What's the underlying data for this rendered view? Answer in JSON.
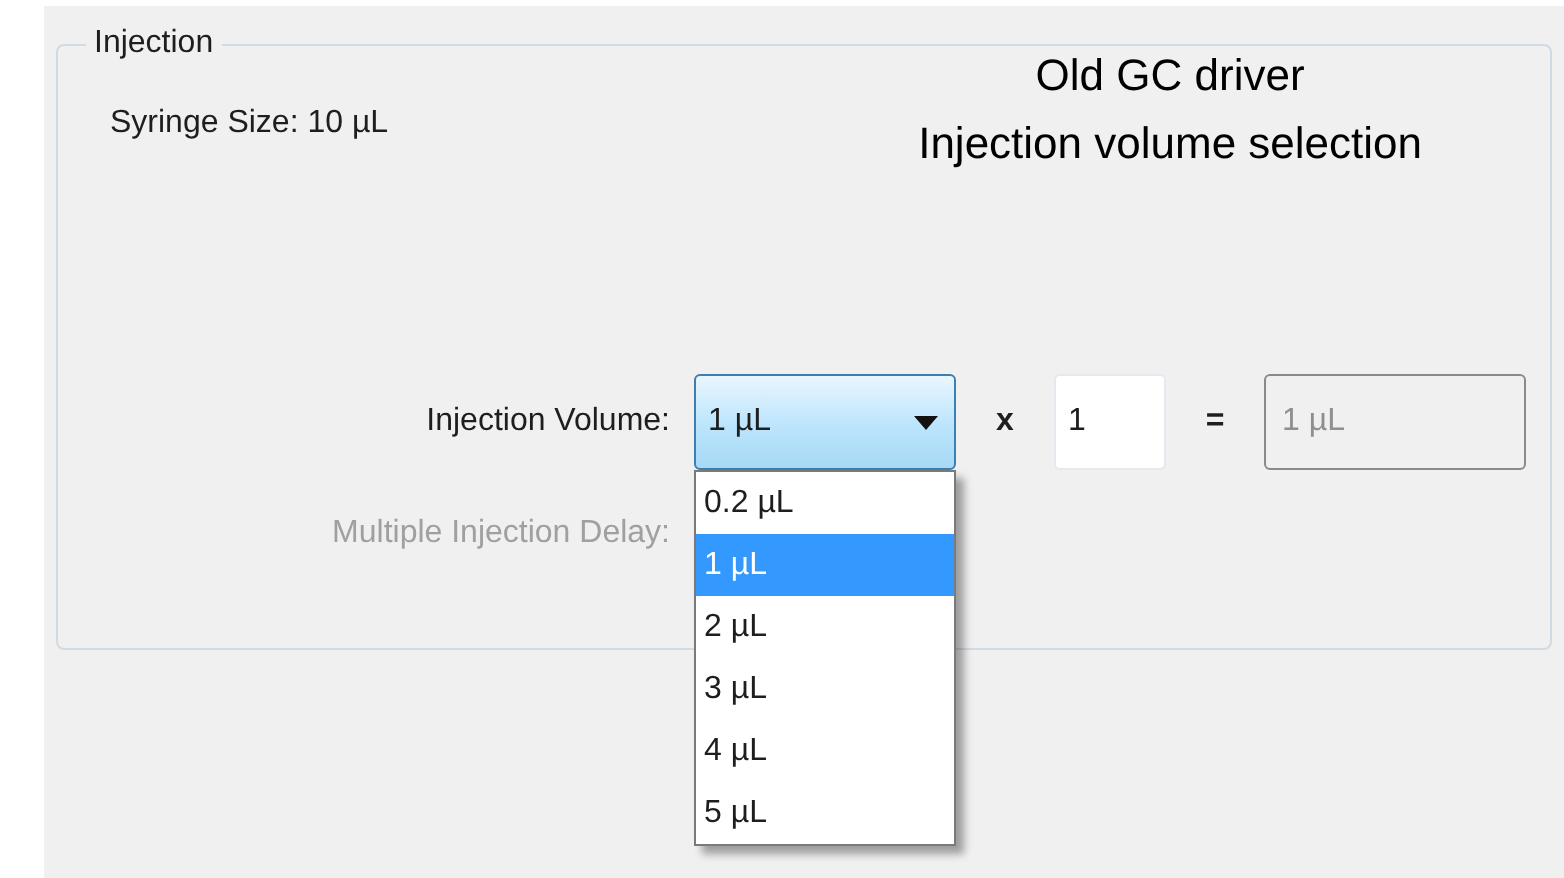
{
  "group": {
    "title": "Injection"
  },
  "syringe_size": "Syringe Size: 10 µL",
  "annotation": [
    "Old GC driver",
    "Injection volume selection"
  ],
  "injection_volume": {
    "label": "Injection Volume:",
    "value": "1 µL",
    "expanded": true,
    "options": [
      {
        "label": "0.2 µL",
        "selected": false
      },
      {
        "label": "1 µL",
        "selected": true
      },
      {
        "label": "2 µL",
        "selected": false
      },
      {
        "label": "3 µL",
        "selected": false
      },
      {
        "label": "4 µL",
        "selected": false
      },
      {
        "label": "5 µL",
        "selected": false
      }
    ]
  },
  "multiplier": {
    "symbol": "x",
    "value": "1"
  },
  "equals": "=",
  "result": {
    "value": "1 µL",
    "disabled": true
  },
  "multiple_injection_delay": {
    "label": "Multiple Injection Delay:",
    "disabled": true
  }
}
